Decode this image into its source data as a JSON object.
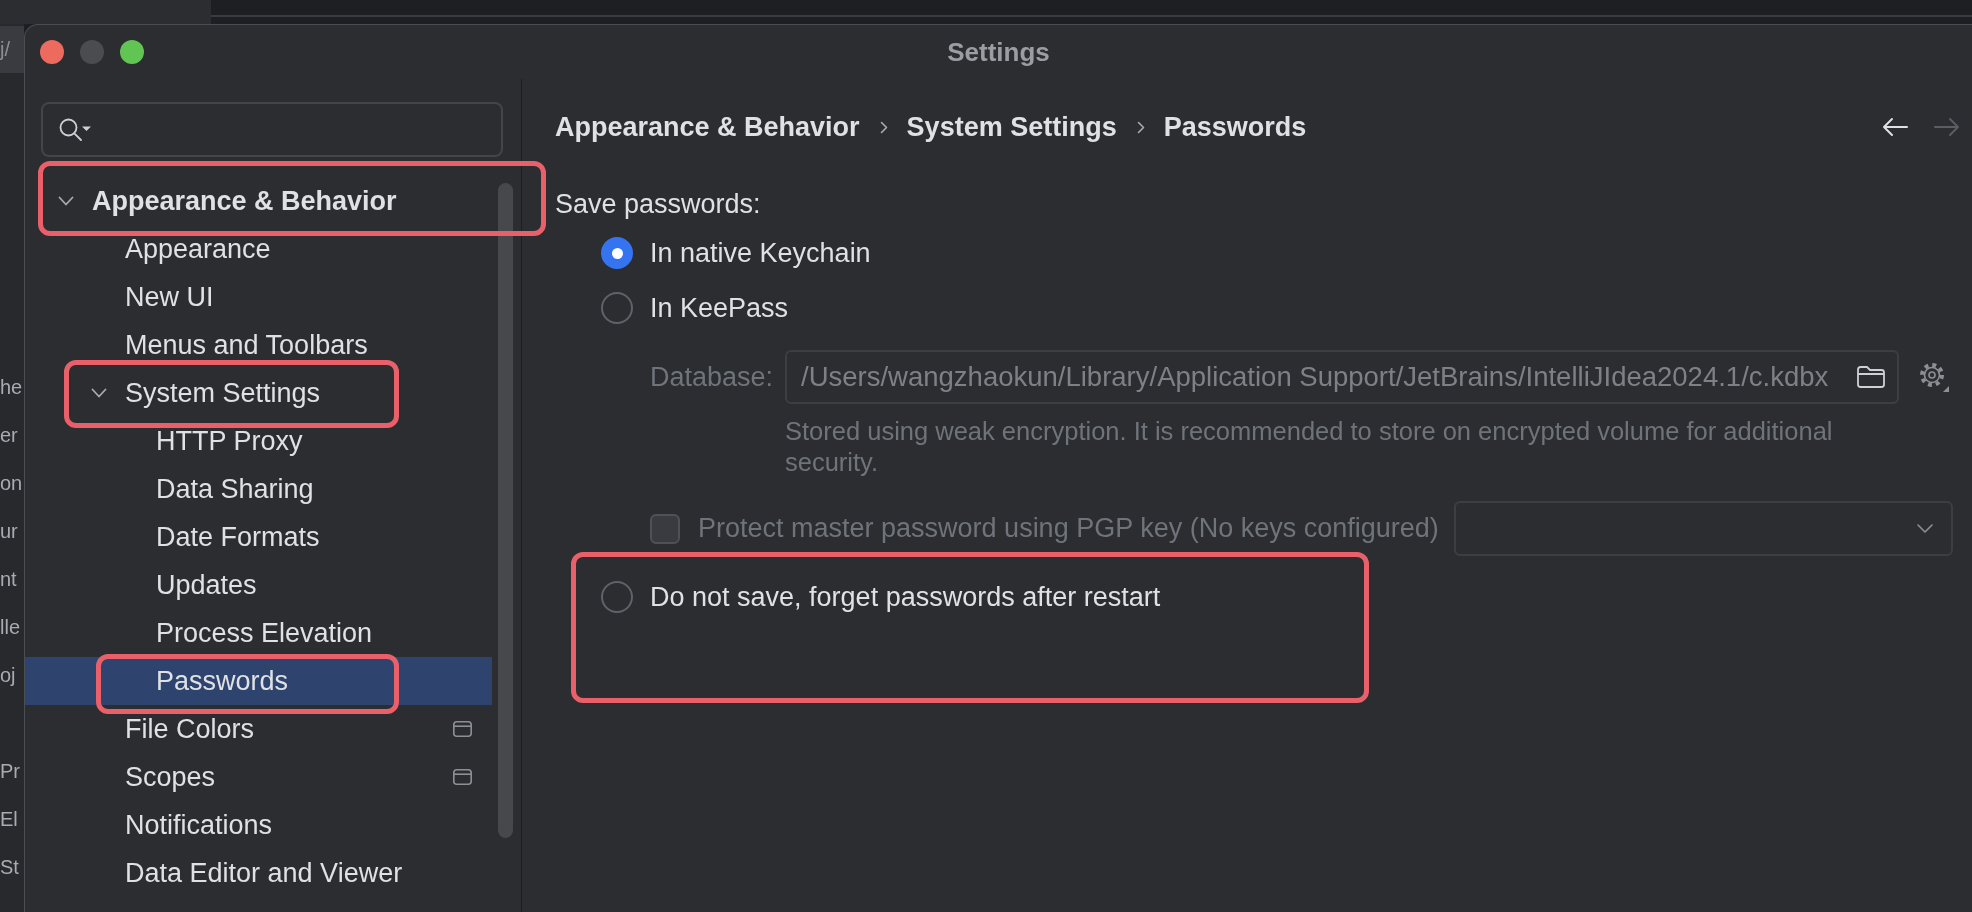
{
  "background_window": {
    "tab": "j/",
    "upper_lines": [
      "he",
      "er",
      "on",
      "ur",
      "nt",
      "lle",
      "oj"
    ],
    "lower_lines": [
      "Pr",
      "El",
      "St"
    ]
  },
  "window": {
    "title": "Settings"
  },
  "sidebar": {
    "tree": [
      {
        "label": "Appearance & Behavior",
        "expanded": true,
        "selected": false,
        "annotated": true,
        "project_level": false,
        "children": [
          {
            "label": "Appearance",
            "selected": false,
            "annotated": false,
            "project_level": false
          },
          {
            "label": "New UI",
            "selected": false,
            "annotated": false,
            "project_level": false
          },
          {
            "label": "Menus and Toolbars",
            "selected": false,
            "annotated": false,
            "project_level": false
          },
          {
            "label": "System Settings",
            "expanded": true,
            "selected": false,
            "annotated": true,
            "project_level": false,
            "children": [
              {
                "label": "HTTP Proxy",
                "selected": false,
                "annotated": false,
                "project_level": false
              },
              {
                "label": "Data Sharing",
                "selected": false,
                "annotated": false,
                "project_level": false
              },
              {
                "label": "Date Formats",
                "selected": false,
                "annotated": false,
                "project_level": false
              },
              {
                "label": "Updates",
                "selected": false,
                "annotated": false,
                "project_level": false
              },
              {
                "label": "Process Elevation",
                "selected": false,
                "annotated": false,
                "project_level": false
              },
              {
                "label": "Passwords",
                "selected": true,
                "annotated": true,
                "project_level": false
              }
            ]
          },
          {
            "label": "File Colors",
            "selected": false,
            "annotated": false,
            "project_level": true
          },
          {
            "label": "Scopes",
            "selected": false,
            "annotated": false,
            "project_level": true
          },
          {
            "label": "Notifications",
            "selected": false,
            "annotated": false,
            "project_level": false
          },
          {
            "label": "Data Editor and Viewer",
            "selected": false,
            "annotated": false,
            "project_level": false
          }
        ]
      }
    ]
  },
  "main": {
    "breadcrumb": [
      "Appearance & Behavior",
      "System Settings",
      "Passwords"
    ],
    "navigation": [
      {
        "kind": "back",
        "disabled": false
      },
      {
        "kind": "forward",
        "disabled": true
      }
    ],
    "save_passwords": {
      "label": "Save passwords:",
      "options": [
        {
          "label": "In native Keychain",
          "selected": true,
          "annotated": false
        },
        {
          "label": "In KeePass",
          "selected": false,
          "annotated": false,
          "settings": {
            "disabled": true,
            "database_label": "Database:",
            "database_path": "/Users/wangzhaokun/Library/Application Support/JetBrains/IntelliJIdea2024.1/c.kdbx",
            "note": "Stored using weak encryption. It is recommended to store on encrypted volume for additional security.",
            "pgp": {
              "label": "Protect master password using PGP key (No keys configured)",
              "checked": false
            }
          }
        },
        {
          "label": "Do not save, forget passwords after restart",
          "selected": false,
          "annotated": true
        }
      ]
    }
  }
}
